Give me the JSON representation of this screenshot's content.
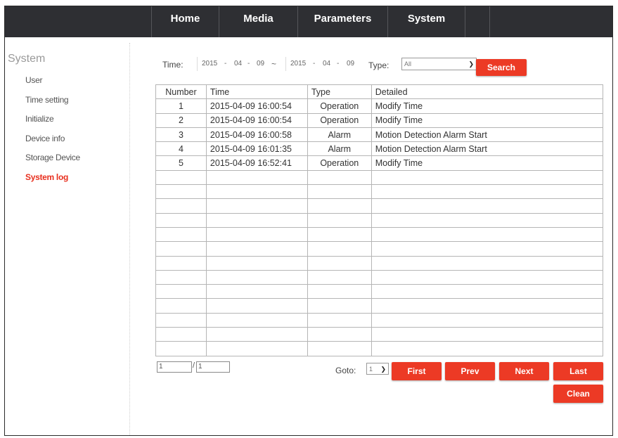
{
  "nav": {
    "tabs": [
      "Home",
      "Media",
      "Parameters",
      "System"
    ]
  },
  "sidebar": {
    "title": "System",
    "items": [
      {
        "label": "User"
      },
      {
        "label": "Time setting"
      },
      {
        "label": "Initialize"
      },
      {
        "label": "Device info"
      },
      {
        "label": "Storage Device"
      },
      {
        "label": "System log",
        "active": true
      }
    ]
  },
  "filter": {
    "time_label": "Time:",
    "from": {
      "year": "2015",
      "month": "04",
      "day": "09"
    },
    "range_sep": "~",
    "to": {
      "year": "2015",
      "month": "04",
      "day": "09"
    },
    "date_sep": "-",
    "type_label": "Type:",
    "type_value": "All",
    "search_label": "Search"
  },
  "table": {
    "headers": [
      "Number",
      "Time",
      "Type",
      "Detailed"
    ],
    "rows": [
      [
        "1",
        "2015-04-09 16:00:54",
        "Operation",
        "Modify Time"
      ],
      [
        "2",
        "2015-04-09 16:00:54",
        "Operation",
        "Modify Time"
      ],
      [
        "3",
        "2015-04-09 16:00:58",
        "Alarm",
        "Motion Detection Alarm Start"
      ],
      [
        "4",
        "2015-04-09 16:01:35",
        "Alarm",
        "Motion Detection Alarm Start"
      ],
      [
        "5",
        "2015-04-09 16:52:41",
        "Operation",
        "Modify Time"
      ]
    ],
    "empty_rows": 13
  },
  "pager": {
    "current": "1",
    "separator": "/",
    "total": "1",
    "goto_label": "Goto:",
    "goto_value": "1",
    "first_label": "First",
    "prev_label": "Prev",
    "next_label": "Next",
    "last_label": "Last",
    "clean_label": "Clean"
  },
  "colors": {
    "accent": "#ec3a25",
    "topbar": "#2e2f33",
    "active_item": "#e8301f"
  }
}
